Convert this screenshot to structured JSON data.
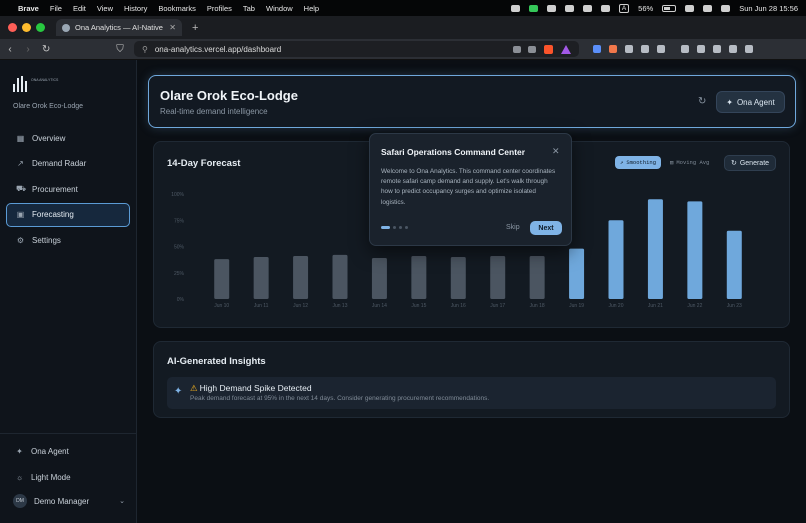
{
  "os_menubar": {
    "app": "Brave",
    "items": [
      "File",
      "Edit",
      "View",
      "History",
      "Bookmarks",
      "Profiles",
      "Tab",
      "Window",
      "Help"
    ],
    "battery": "56%",
    "input_source": "A",
    "datetime": "Sun Jun 28  15:56"
  },
  "browser": {
    "tab_title": "Ona Analytics — AI-Native De",
    "url": "ona-analytics.vercel.app/dashboard",
    "traffic_colors": [
      "#ff5f57",
      "#febc2e",
      "#28c840"
    ]
  },
  "sidebar": {
    "lodge_name": "Olare Orok Eco-Lodge",
    "brand_small": "ONA ANALYTICS",
    "items": [
      {
        "label": "Overview",
        "icon": "grid-icon"
      },
      {
        "label": "Demand Radar",
        "icon": "trend-icon"
      },
      {
        "label": "Procurement",
        "icon": "truck-icon"
      },
      {
        "label": "Forecasting",
        "icon": "calendar-icon",
        "active": true
      },
      {
        "label": "Settings",
        "icon": "gear-icon"
      }
    ],
    "agent_label": "Ona Agent",
    "theme_label": "Light Mode",
    "user": {
      "initials": "DM",
      "name": "Demo Manager"
    }
  },
  "hero": {
    "title": "Olare Orok Eco-Lodge",
    "subtitle": "Real-time demand intelligence",
    "agent_button": "Ona Agent"
  },
  "forecast": {
    "title": "14-Day Forecast",
    "toggle_smoothing": "Smoothing",
    "toggle_moving_avg": "Moving Avg",
    "generate_button": "Generate"
  },
  "chart_data": {
    "type": "bar",
    "categories": [
      "Jun 10",
      "Jun 11",
      "Jun 12",
      "Jun 13",
      "Jun 14",
      "Jun 15",
      "Jun 16",
      "Jun 17",
      "Jun 18",
      "Jun 19",
      "Jun 20",
      "Jun 21",
      "Jun 22",
      "Jun 23"
    ],
    "values": [
      38,
      40,
      41,
      42,
      39,
      41,
      40,
      41,
      41,
      48,
      75,
      95,
      93,
      65
    ],
    "ytick_labels": [
      "0%",
      "25%",
      "50%",
      "75%",
      "100%"
    ],
    "ylim": [
      0,
      100
    ],
    "grid": false,
    "colors": {
      "historical": "#4b5561",
      "forecast": "#6fa8dc"
    },
    "forecast_start_index": 9
  },
  "insights": {
    "title": "AI-Generated Insights",
    "items": [
      {
        "heading": "High Demand Spike Detected",
        "body": "Peak demand forecast at 95% in the next 14 days. Consider generating procurement recommendations."
      }
    ]
  },
  "tour": {
    "title": "Safari Operations Command Center",
    "body": "Welcome to Ona Analytics. This command center coordinates remote safari camp demand and supply. Let's walk through how to predict occupancy surges and optimize isolated logistics.",
    "skip": "Skip",
    "next": "Next",
    "step": 1,
    "total_steps": 4
  }
}
